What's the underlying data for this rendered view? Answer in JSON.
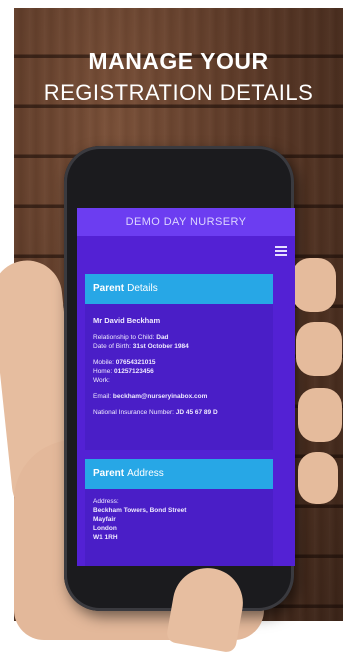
{
  "headline": {
    "line1": "MANAGE YOUR",
    "line2": "REGISTRATION DETAILS"
  },
  "app": {
    "title": "DEMO DAY NURSERY",
    "menu_icon": "hamburger-menu-icon"
  },
  "parent_details": {
    "heading_bold": "Parent",
    "heading_light": "Details",
    "name": "Mr David Beckham",
    "relationship_label": "Relationship to Child:",
    "relationship_value": "Dad",
    "dob_label": "Date of Birth:",
    "dob_value": "31st October 1984",
    "mobile_label": "Mobile:",
    "mobile_value": "07654321015",
    "home_label": "Home:",
    "home_value": "01257123456",
    "work_label": "Work:",
    "email_label": "Email:",
    "email_value": "beckham@nurseryinabox.com",
    "ni_label": "National Insurance Number:",
    "ni_value": "JD 45 67 89 D"
  },
  "parent_address": {
    "heading_bold": "Parent",
    "heading_light": "Address",
    "address_label": "Address:",
    "lines": [
      "Beckham Towers, Bond Street",
      "Mayfair",
      "London",
      "W1 1RH"
    ]
  },
  "colors": {
    "screen_bg": "#5321d4",
    "appbar": "#6c3df1",
    "card_header": "#27a7e6"
  }
}
